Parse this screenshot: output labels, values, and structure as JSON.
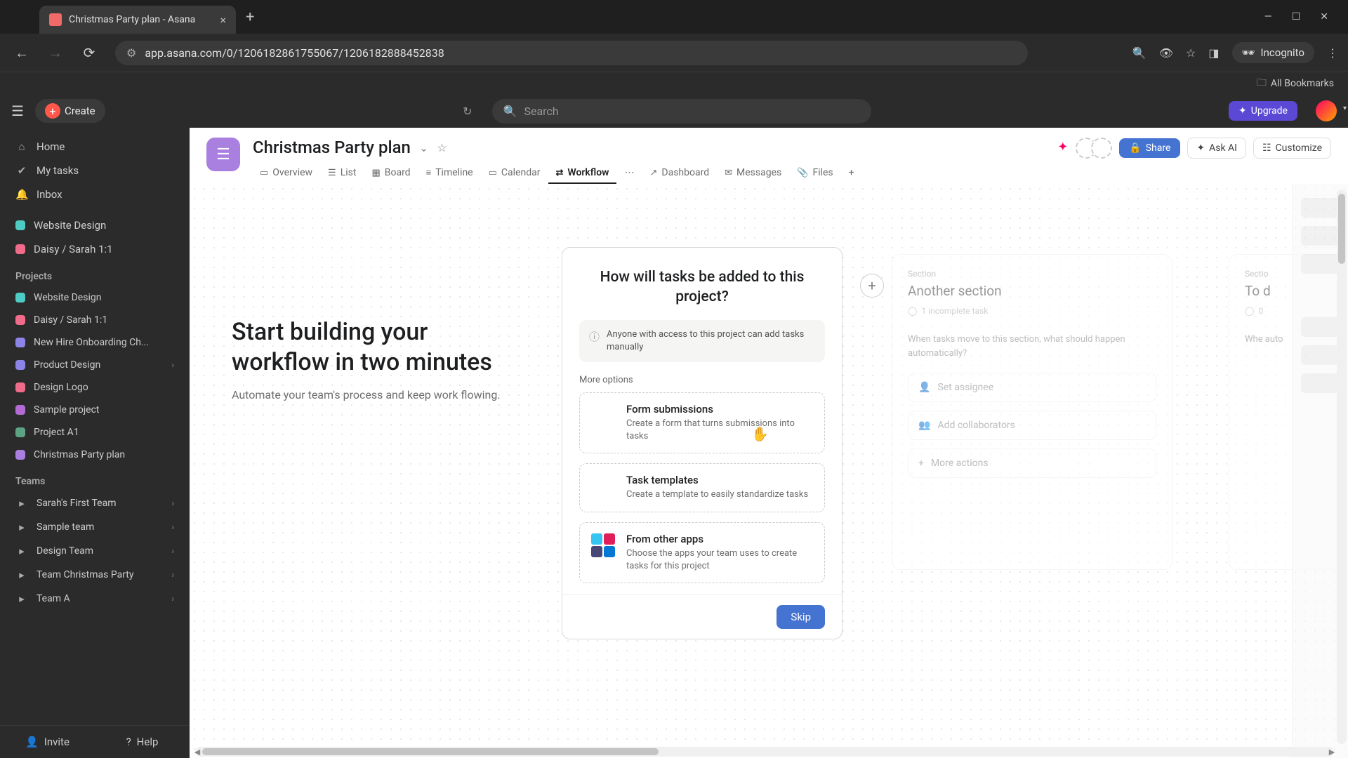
{
  "browser": {
    "tab_title": "Christmas Party plan - Asana",
    "url": "app.asana.com/0/1206182861755067/1206182888452838",
    "incognito_label": "Incognito",
    "all_bookmarks": "All Bookmarks"
  },
  "app_header": {
    "create_label": "Create",
    "search_placeholder": "Search",
    "upgrade_label": "Upgrade"
  },
  "sidebar": {
    "home": "Home",
    "my_tasks": "My tasks",
    "inbox": "Inbox",
    "pinned": [
      {
        "label": "Website Design",
        "color": "#4ecbc4"
      },
      {
        "label": "Daisy / Sarah 1:1",
        "color": "#f06a8a"
      }
    ],
    "projects_heading": "Projects",
    "projects": [
      {
        "label": "Website Design",
        "color": "#4ecbc4",
        "chev": false
      },
      {
        "label": "Daisy / Sarah 1:1",
        "color": "#f06a8a",
        "chev": false
      },
      {
        "label": "New Hire Onboarding Ch...",
        "color": "#8d84e8",
        "chev": false
      },
      {
        "label": "Product Design",
        "color": "#8d84e8",
        "chev": true
      },
      {
        "label": "Design Logo",
        "color": "#f06a8a",
        "chev": false
      },
      {
        "label": "Sample project",
        "color": "#b36bd4",
        "chev": false
      },
      {
        "label": "Project A1",
        "color": "#5da283",
        "chev": false
      },
      {
        "label": "Christmas Party plan",
        "color": "#a97fe0",
        "chev": false
      }
    ],
    "teams_heading": "Teams",
    "teams": [
      {
        "label": "Sarah's First Team"
      },
      {
        "label": "Sample team"
      },
      {
        "label": "Design Team"
      },
      {
        "label": "Team Christmas Party"
      },
      {
        "label": "Team A"
      }
    ],
    "invite": "Invite",
    "help": "Help"
  },
  "project": {
    "title": "Christmas Party plan",
    "tabs": [
      {
        "icon": "▭",
        "label": "Overview"
      },
      {
        "icon": "☰",
        "label": "List"
      },
      {
        "icon": "▦",
        "label": "Board"
      },
      {
        "icon": "≡",
        "label": "Timeline"
      },
      {
        "icon": "▭",
        "label": "Calendar"
      },
      {
        "icon": "⇄",
        "label": "Workflow"
      },
      {
        "icon": "↗",
        "label": "Dashboard"
      },
      {
        "icon": "✉",
        "label": "Messages"
      },
      {
        "icon": "📎",
        "label": "Files"
      }
    ],
    "active_tab": 5,
    "share": "Share",
    "ask_ai": "Ask AI",
    "customize": "Customize"
  },
  "intro": {
    "title": "Start building your workflow in two minutes",
    "subtitle": "Automate your team's process and keep work flowing."
  },
  "modal": {
    "title": "How will tasks be added to this project?",
    "info": "Anyone with access to this project can add tasks manually",
    "more": "More options",
    "options": [
      {
        "title": "Form submissions",
        "desc": "Create a form that turns submissions into tasks"
      },
      {
        "title": "Task templates",
        "desc": "Create a template to easily standardize tasks"
      },
      {
        "title": "From other apps",
        "desc": "Choose the apps your team uses to create tasks for this project"
      }
    ],
    "skip": "Skip"
  },
  "sections": {
    "s1": {
      "kicker": "Section",
      "title": "Another section",
      "count": "1 incomplete task",
      "hint": "When tasks move to this section, what should happen automatically?",
      "actions": [
        "Set assignee",
        "Add collaborators",
        "More actions"
      ]
    },
    "s2": {
      "kicker": "Sectio",
      "title": "To d",
      "count": "0",
      "hint": "Whe auto"
    }
  }
}
